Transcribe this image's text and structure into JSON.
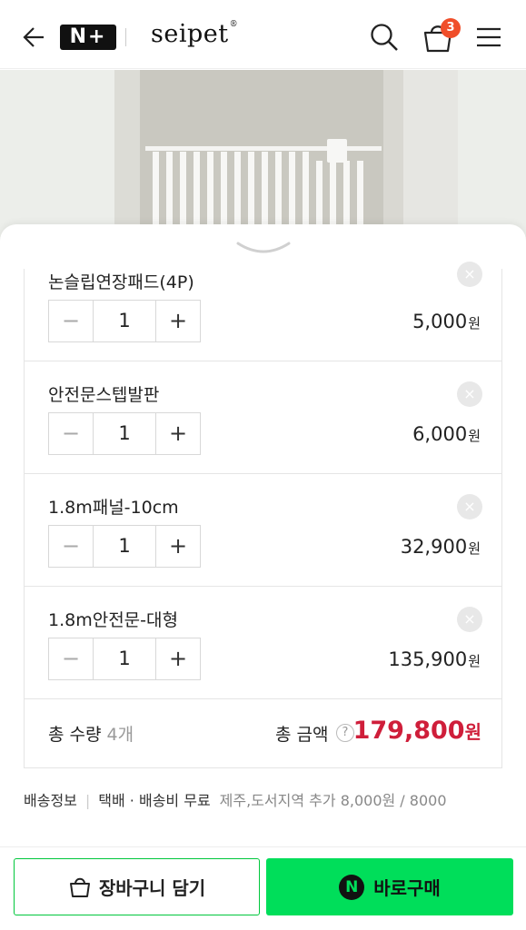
{
  "header": {
    "badge": "N+",
    "brand": "seipet",
    "brand_mark": "®",
    "cart_count": "3"
  },
  "options": [
    {
      "name": "논슬립연장패드(4P)",
      "qty": "1",
      "price": "5,000",
      "won": "원"
    },
    {
      "name": "안전문스텝발판",
      "qty": "1",
      "price": "6,000",
      "won": "원"
    },
    {
      "name": "1.8m패널-10cm",
      "qty": "1",
      "price": "32,900",
      "won": "원"
    },
    {
      "name": "1.8m안전문-대형",
      "qty": "1",
      "price": "135,900",
      "won": "원"
    }
  ],
  "stepper": {
    "minus": "−",
    "plus": "+"
  },
  "close_symbol": "×",
  "total": {
    "qty_label": "총 수량",
    "qty_count": "4개",
    "amount_label": "총 금액",
    "help": "?",
    "amount": "179,800",
    "won": "원"
  },
  "shipping": {
    "label": "배송정보",
    "type": "택배 · 배송비 무료",
    "extra": "제주,도서지역 추가 8,000원 / 8000"
  },
  "buttons": {
    "cart": "장바구니 담기",
    "buy": "바로구매",
    "npay": "N"
  },
  "colors": {
    "accent_green": "#00de5a",
    "price_red": "#cf1e3a",
    "badge_orange": "#f04e2a"
  }
}
